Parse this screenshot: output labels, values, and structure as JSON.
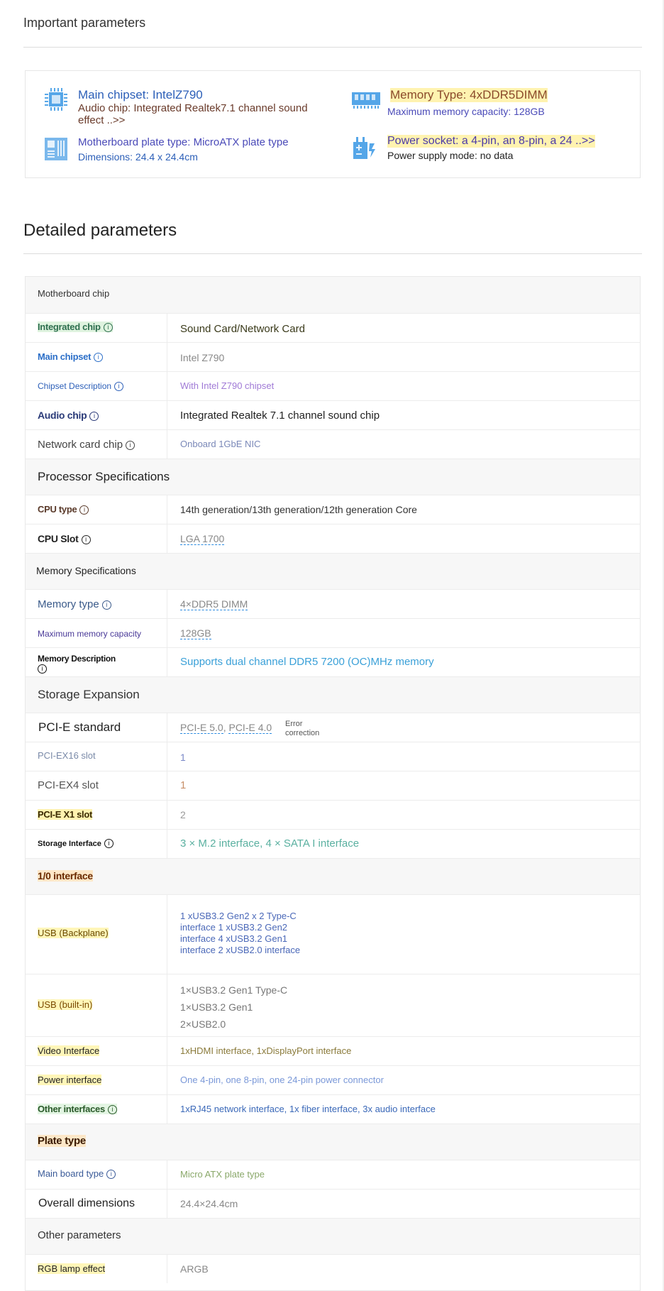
{
  "important": {
    "title": "Important parameters",
    "chipset": {
      "title": "Main chipset: IntelZ790",
      "sub1": "Audio chip: Integrated Realtek7.1 channel sound",
      "sub2": "effect ..>>"
    },
    "memory": {
      "title": "Memory Type: 4xDDR5DIMM",
      "sub": "Maximum memory capacity: 128GB"
    },
    "board": {
      "title": "Motherboard plate type: MicroATX plate type",
      "sub": "Dimensions: 24.4 x 24.4cm"
    },
    "power": {
      "title": "Power socket: a 4-pin, an 8-pin, a 24 ..>>",
      "sub": "Power supply mode: no data"
    }
  },
  "detailed": {
    "title": "Detailed parameters",
    "info_glyph": "i",
    "cats": {
      "c1": "Motherboard chip",
      "c2": "Processor Specifications",
      "c3": "Memory Specifications",
      "c4": "Storage Expansion",
      "c5": "1/0 interface",
      "c6": "Plate type",
      "c7": "Other parameters"
    },
    "rows": {
      "integrated_chip": {
        "label": "Integrated chip",
        "value": "Sound Card/Network Card"
      },
      "main_chipset": {
        "label": "Main chipset",
        "value": "Intel Z790"
      },
      "chipset_desc": {
        "label": "Chipset Description",
        "value": "With Intel Z790 chipset"
      },
      "audio_chip": {
        "label": "Audio chip",
        "value": "Integrated Realtek 7.1 channel sound chip"
      },
      "network_chip": {
        "label": "Network card chip",
        "value": "Onboard 1GbE NIC"
      },
      "cpu_type": {
        "label": "CPU type",
        "value": "14th generation/13th generation/12th generation Core"
      },
      "cpu_slot": {
        "label": "CPU Slot",
        "value": "LGA 1700"
      },
      "memory_type": {
        "label": "Memory type",
        "value": "4×DDR5 DIMM"
      },
      "max_memory": {
        "label": "Maximum memory capacity",
        "value": "128GB"
      },
      "memory_desc": {
        "label": "Memory Description",
        "value": "Supports dual channel DDR5 7200 (OC)MHz memory"
      },
      "pcie_std": {
        "label": "PCI-E standard",
        "value1": "PCI-E 5.0",
        "sep": ",",
        "value2": "PCI-E 4.0",
        "note1": "Error",
        "note2": "correction"
      },
      "pciex16": {
        "label": "PCI-EX16 slot",
        "value": "1"
      },
      "pciex4": {
        "label": "PCI-EX4 slot",
        "value": "1"
      },
      "pciex1": {
        "label": "PCI-E X1 slot",
        "value": "2"
      },
      "storage_if": {
        "label": "Storage Interface",
        "value": "3 × M.2 interface, 4 × SATA I interface"
      },
      "usb_back": {
        "label": "USB (Backplane)",
        "lines": [
          "1 xUSB3.2 Gen2 x 2 Type-C",
          "interface 1 xUSB3.2 Gen2",
          "interface 4 xUSB3.2 Gen1",
          "interface 2 xUSB2.0 interface"
        ]
      },
      "usb_built": {
        "label": "USB (built-in)",
        "lines": [
          "1×USB3.2 Gen1 Type-C",
          "1×USB3.2 Gen1",
          "2×USB2.0"
        ]
      },
      "video_if": {
        "label": "Video Interface",
        "value": "1xHDMI interface, 1xDisplayPort interface"
      },
      "power_if": {
        "label": "Power interface",
        "value": "One 4-pin, one 8-pin, one 24-pin power connector"
      },
      "other_if": {
        "label": "Other interfaces",
        "value": "1xRJ45 network interface, 1x fiber interface, 3x audio interface"
      },
      "board_type": {
        "label": "Main board type",
        "value": "Micro ATX plate type"
      },
      "dimensions": {
        "label": "Overall dimensions",
        "value": "24.4×24.4cm"
      },
      "rgb": {
        "label": "RGB lamp effect",
        "value": "ARGB"
      }
    }
  }
}
